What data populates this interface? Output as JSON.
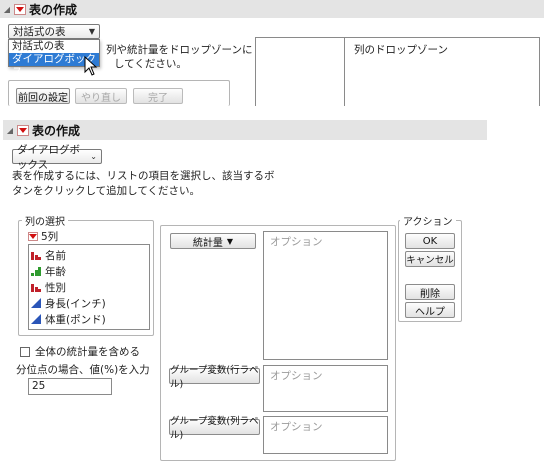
{
  "top": {
    "title": "表の作成",
    "combo_value": "対話式の表",
    "dropdown_options": [
      "対話式の表",
      "ダイアログボックス"
    ],
    "instructions_partial": "列や統計量をドロップゾーンにド",
    "instructions_partial2": "してください。",
    "buttons": {
      "previous": "前回の設定",
      "redo": "やり直し",
      "done": "完了"
    },
    "col_dropzone": "列のドロップゾーン"
  },
  "main": {
    "title": "表の作成",
    "mode_value": "ダイアログボックス",
    "instructions_line1": "表を作成するには、リストの項目を選択し、該当するボ",
    "instructions_line2": "タンをクリックして追加してください。",
    "column_select": {
      "label": "列の選択",
      "count": "5列",
      "items": [
        {
          "name": "名前",
          "icon": "nominal-bar-icon",
          "color": "#c0202a"
        },
        {
          "name": "年齢",
          "icon": "ordinal-bar-icon",
          "color": "#2e9b2e"
        },
        {
          "name": "性別",
          "icon": "nominal-bar-icon",
          "color": "#c0202a"
        },
        {
          "name": "身長(インチ)",
          "icon": "continuous-triangle-icon",
          "color": "#2a55b8"
        },
        {
          "name": "体重(ポンド)",
          "icon": "continuous-triangle-icon",
          "color": "#2a55b8"
        }
      ]
    },
    "include_all_stats": "全体の統計量を含める",
    "quantile_label": "分位点の場合、値(%)を入力",
    "quantile_value": "25",
    "stats_button": "統計量",
    "row_group_button": "グループ変数(行ラベル)",
    "col_group_button": "グループ変数(列ラベル)",
    "options_placeholder": "オプション",
    "actions": {
      "label": "アクション",
      "ok": "OK",
      "cancel": "キャンセル",
      "remove": "削除",
      "help": "ヘルプ"
    }
  }
}
